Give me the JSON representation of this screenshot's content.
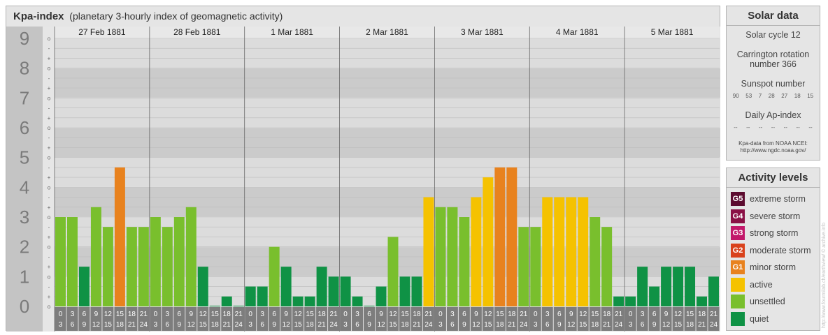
{
  "title": {
    "main": "Kpa-index",
    "sub": "(planetary 3-hourly index of geomagnetic activity)"
  },
  "chart_data": {
    "type": "bar",
    "ylim": [
      0,
      9
    ],
    "y_tick_labels": [
      "0",
      "1",
      "2",
      "3",
      "4",
      "5",
      "6",
      "7",
      "8",
      "9"
    ],
    "minor_tick_labels": [
      "+",
      "o",
      "-"
    ],
    "days": [
      "27 Feb 1881",
      "28 Feb 1881",
      "1 Mar 1881",
      "2 Mar 1881",
      "3 Mar 1881",
      "4 Mar 1881",
      "5 Mar 1881"
    ],
    "slot_start_hours": [
      "0",
      "3",
      "6",
      "9",
      "12",
      "15",
      "18",
      "21"
    ],
    "slot_end_hours": [
      "3",
      "6",
      "9",
      "12",
      "15",
      "18",
      "21",
      "24"
    ],
    "values": [
      3.0,
      3.0,
      1.333,
      3.333,
      2.667,
      4.667,
      2.667,
      2.667,
      3.0,
      2.667,
      3.0,
      3.333,
      1.333,
      0.0,
      0.333,
      0.0,
      0.667,
      0.667,
      2.0,
      1.333,
      0.333,
      0.333,
      1.333,
      1.0,
      1.0,
      0.333,
      0.0,
      0.667,
      2.333,
      1.0,
      1.0,
      3.667,
      3.333,
      3.333,
      3.0,
      3.667,
      4.333,
      4.667,
      4.667,
      2.667,
      2.667,
      3.667,
      3.667,
      3.667,
      3.667,
      3.0,
      2.667,
      0.333,
      0.333,
      1.333,
      0.667,
      1.333,
      1.333,
      1.333,
      0.333,
      1.0
    ],
    "colors": {
      "quiet": "#0f9245",
      "unsettled": "#79bf2d",
      "active": "#f5c200",
      "minor_storm": "#e8821e"
    }
  },
  "solar": {
    "header": "Solar data",
    "cycle": "Solar cycle 12",
    "carrington": "Carrington rotation number 366",
    "sunspot_label": "Sunspot number",
    "sunspots": [
      "90",
      "53",
      "7",
      "28",
      "27",
      "18",
      "15"
    ],
    "ap_label": "Daily Ap-index",
    "ap_values": [
      "--",
      "--",
      "--",
      "--",
      "--",
      "--",
      "--"
    ],
    "source_line1": "Kpa-data from NOAA NCEI:",
    "source_line2": "http://www.ngdc.noaa.gov/"
  },
  "levels": {
    "header": "Activity levels",
    "items": [
      {
        "code": "G5",
        "label": "extreme storm",
        "color": "#5c0b2f"
      },
      {
        "code": "G4",
        "label": "severe storm",
        "color": "#8a1045"
      },
      {
        "code": "G3",
        "label": "strong storm",
        "color": "#c2186a"
      },
      {
        "code": "G2",
        "label": "moderate storm",
        "color": "#d9421c"
      },
      {
        "code": "G1",
        "label": "minor storm",
        "color": "#e8821e"
      },
      {
        "code": "",
        "label": "active",
        "color": "#f5c200"
      },
      {
        "code": "",
        "label": "unsettled",
        "color": "#79bf2d"
      },
      {
        "code": "",
        "label": "quiet",
        "color": "#0f9245"
      }
    ]
  },
  "credit": "http://www.fourmilab.ch/earthview/ © archive.info"
}
